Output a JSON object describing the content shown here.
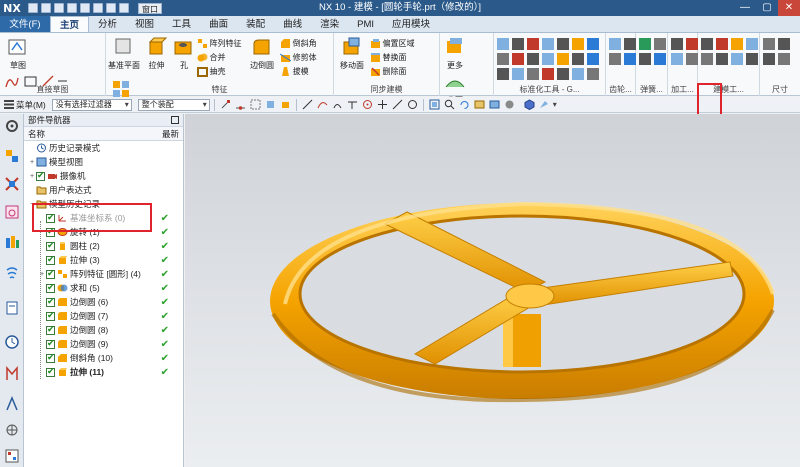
{
  "app": {
    "logo": "NX",
    "title": "NX 10 - 建模 - [圆轮手轮.prt（修改的）]",
    "window_menu": "窗口",
    "window_controls": [
      "—",
      "▢",
      "✕"
    ]
  },
  "menu": {
    "file": "文件(F)",
    "tabs": [
      "主页",
      "分析",
      "视图",
      "工具",
      "曲面",
      "装配",
      "曲线",
      "渲染",
      "PMI",
      "应用模块"
    ],
    "active_tab": "主页"
  },
  "ribbon": {
    "sketch": "草图",
    "direct_sketch_label": "直接草图",
    "datum_plane": "基准平面",
    "extrude": "拉伸",
    "hole": "孔",
    "pattern_feature": "阵列特征",
    "unite": "合并",
    "shell": "抽壳",
    "edge_blend": "边倒圆",
    "chamfer": "倒斜角",
    "trim_body": "修剪体",
    "draft": "拔模",
    "more": "更多",
    "feature_label": "特征",
    "move_face": "移动面",
    "offset_region": "偏置区域",
    "replace_face": "替换面",
    "delete_face": "删除面",
    "sync_label": "同步建模",
    "surface": "曲面",
    "standard_label": "标准化工具 - G...",
    "gear_label": "齿轮...",
    "spring_label": "弹簧...",
    "machining_label": "加工...",
    "build_label": "建模工...",
    "size_label": "尺寸"
  },
  "toolbar2": {
    "menu": "菜单(M)",
    "filter": "没有选择过滤器",
    "assembly": "整个装配"
  },
  "navigator": {
    "title": "部件导航器",
    "col_name": "名称",
    "col_latest": "最新",
    "items": [
      {
        "label": "历史记录模式",
        "level": 1
      },
      {
        "label": "模型视图",
        "level": 1
      },
      {
        "label": "摄像机",
        "level": 1
      },
      {
        "label": "用户表达式",
        "level": 1
      },
      {
        "label": "模型历史记录",
        "level": 1
      },
      {
        "label": "基准坐标系 (0)",
        "level": 2
      },
      {
        "label": "旋转 (1)",
        "level": 2
      },
      {
        "label": "圆柱 (2)",
        "level": 2
      },
      {
        "label": "拉伸 (3)",
        "level": 2
      },
      {
        "label": "阵列特征 [圆形] (4)",
        "level": 2
      },
      {
        "label": "求和 (5)",
        "level": 2
      },
      {
        "label": "边倒圆 (6)",
        "level": 2
      },
      {
        "label": "边倒圆 (7)",
        "level": 2
      },
      {
        "label": "边倒圆 (8)",
        "level": 2
      },
      {
        "label": "边倒圆 (9)",
        "level": 2
      },
      {
        "label": "倒斜角 (10)",
        "level": 2
      },
      {
        "label": "拉伸 (11)",
        "level": 2
      }
    ]
  },
  "colors": {
    "titlebar": "#2b5a8a",
    "model": "#f5a300",
    "highlight": "#e0242b",
    "latest_check": "#2aa22a"
  }
}
